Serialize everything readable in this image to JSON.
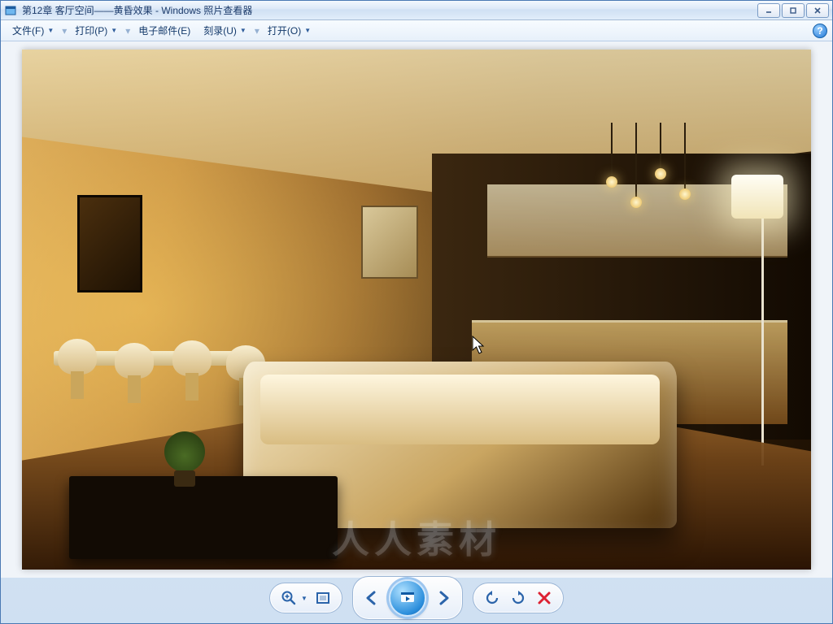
{
  "window": {
    "title": "第12章  客厅空间——黄昏效果 - Windows 照片查看器"
  },
  "menu": {
    "file": "文件(F)",
    "print": "打印(P)",
    "email": "电子邮件(E)",
    "burn": "刻录(U)",
    "open": "打开(O)",
    "help": "?"
  },
  "toolbar": {
    "zoom": "zoom-slider",
    "fit": "fit-to-window",
    "prev": "previous-image",
    "slideshow": "play-slideshow",
    "next": "next-image",
    "rotate_ccw": "rotate-counterclockwise",
    "rotate_cw": "rotate-clockwise",
    "delete": "delete-image"
  },
  "image": {
    "description": "3D 渲染的客厅黄昏效果：左侧餐桌与椅子，中部浅色布艺沙发与深色茶几及绿植，右侧开放式厨房、吧台与吊灯，落地灯点亮暖光",
    "cursor_visible": true
  },
  "watermark": "人人素材"
}
